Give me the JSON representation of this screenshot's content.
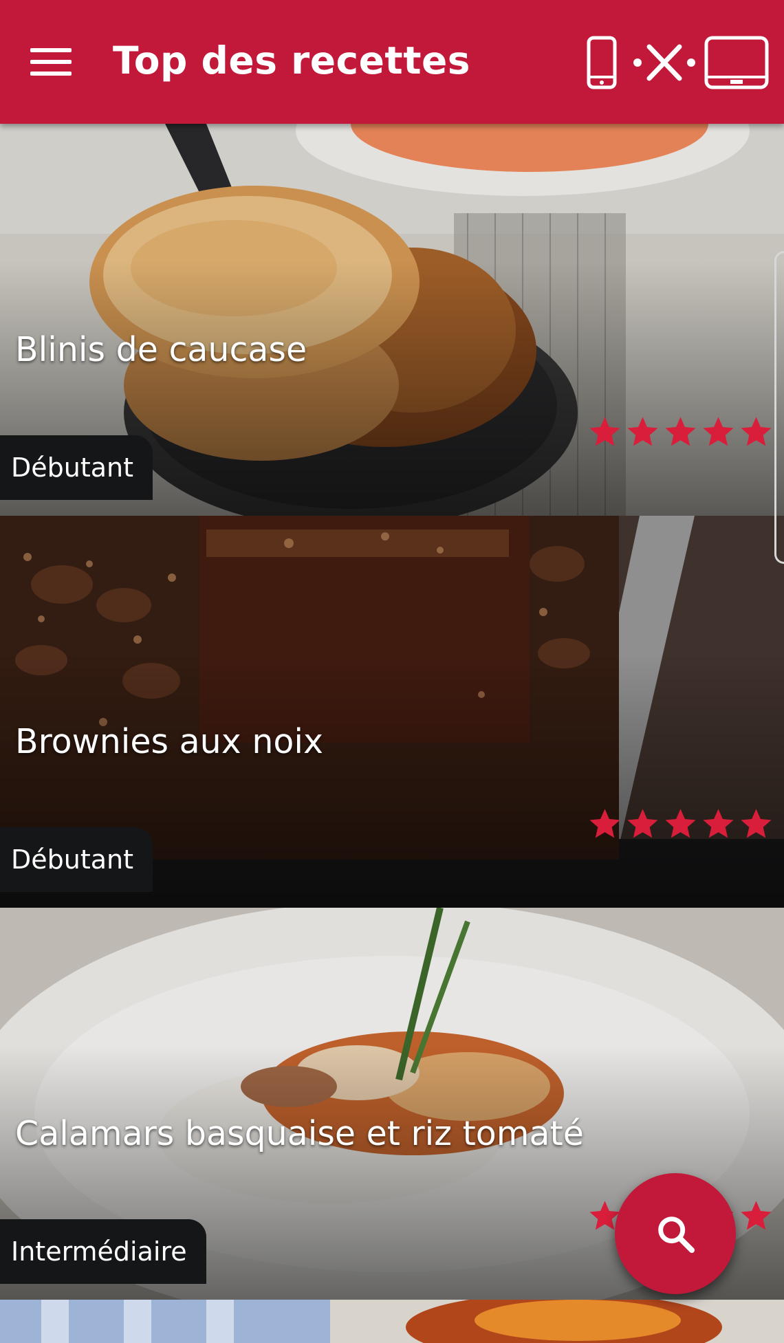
{
  "appbar": {
    "title": "Top des recettes",
    "background": "#c2183a",
    "icons": [
      "menu-icon",
      "phone-icon",
      "connect-icon",
      "tablet-icon"
    ]
  },
  "recipes": [
    {
      "name": "Blinis de caucase",
      "level": "Débutant",
      "rating": 5
    },
    {
      "name": "Brownies aux noix",
      "level": "Débutant",
      "rating": 5
    },
    {
      "name": "Calamars basquaise et riz tomaté",
      "level": "Intermédiaire",
      "rating": 5
    }
  ],
  "accent": "#d81e3a",
  "fab": {
    "icon": "search-icon"
  }
}
